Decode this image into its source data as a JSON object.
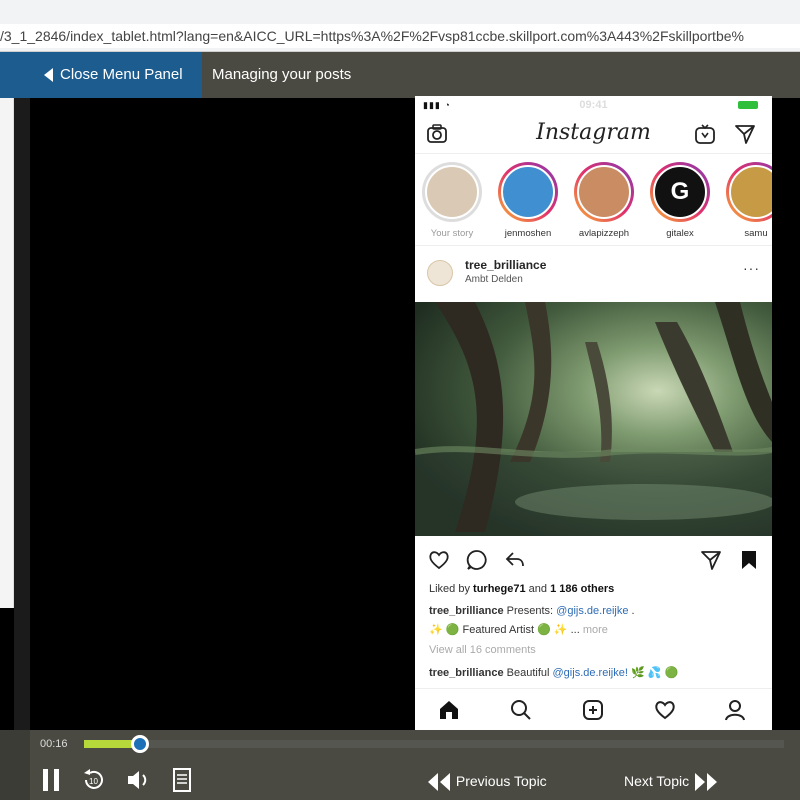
{
  "browser": {
    "url": "/3_1_2846/index_tablet.html?lang=en&AICC_URL=https%3A%2F%2Fvsp81ccbe.skillport.com%3A443%2Fskillportbe%"
  },
  "topbar": {
    "close_menu_label": "Close Menu Panel",
    "topic_title": "Managing your posts"
  },
  "phone": {
    "status_time": "09:41",
    "app_logo": "Instagram",
    "stories": [
      {
        "name": "Your story",
        "color": "#d9c9b5"
      },
      {
        "name": "jenmoshen",
        "color": "#3f8fd1"
      },
      {
        "name": "avlapizzeph",
        "color": "#c98c63"
      },
      {
        "name": "gitalex",
        "color": "#111111"
      },
      {
        "name": "samu",
        "color": "#c79a45"
      }
    ],
    "story_badge": "G",
    "post": {
      "username": "tree_brilliance",
      "location": "Ambt Delden",
      "more": "···",
      "liked_prefix": "Liked by ",
      "liked_user": "turhege71",
      "liked_mid": " and ",
      "liked_count": "1 186 others",
      "caption_user": "tree_brilliance",
      "caption_text": " Presents: ",
      "caption_link": "@gijs.de.reijke",
      "caption_end": " .",
      "caption_line2": "✨ 🟢 Featured Artist 🟢 ✨ ...",
      "caption_more": "more",
      "view_all": "View all 16 comments",
      "comment_user": "tree_brilliance",
      "comment_text": " Beautiful ",
      "comment_link": "@gijs.de.reijke!",
      "comment_end": " 🌿 💦 🟢"
    }
  },
  "player": {
    "time": "00:16",
    "progress_fraction": 0.08,
    "previous_label": "Previous Topic",
    "next_label": "Next Topic"
  },
  "colors": {
    "accent_blue": "#1d5c8e",
    "progress_green": "#b7d83a",
    "bar_bg": "#4a4a42"
  },
  "icons": [
    "camera-icon",
    "igtv-icon",
    "direct-icon",
    "heart-icon",
    "comment-icon",
    "share-icon",
    "save-icon",
    "home-icon",
    "search-icon",
    "add-post-icon",
    "activity-icon",
    "profile-icon",
    "pause-icon",
    "replay-10-icon",
    "volume-icon",
    "transcript-icon",
    "previous-icon",
    "next-icon"
  ]
}
